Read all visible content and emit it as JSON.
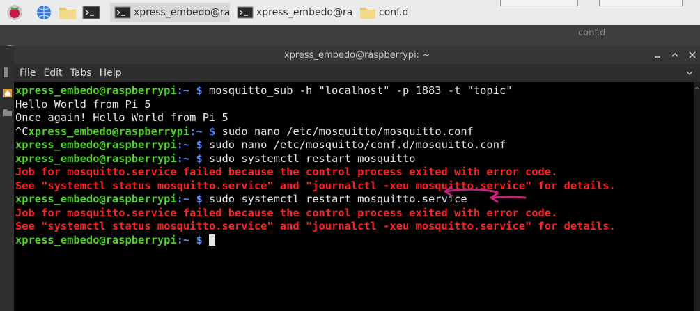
{
  "taskbar": {
    "tasks": [
      {
        "label": "xpress_embedo@ras..."
      },
      {
        "label": "xpress_embedo@ras..."
      },
      {
        "label": "conf.d"
      }
    ]
  },
  "background_window": {
    "title": "conf.d",
    "left_text": "Fi"
  },
  "terminal": {
    "title": "xpress_embedo@raspberrypi: ~",
    "menu": [
      "File",
      "Edit",
      "Tabs",
      "Help"
    ],
    "prompt_user": "xpress_embedo@raspberrypi",
    "prompt_path": ":~ $",
    "lines": [
      {
        "type": "cmd",
        "prefix": "",
        "text": " mosquitto_sub -h \"localhost\" -p 1883 -t \"topic\""
      },
      {
        "type": "out",
        "text": "Hello World from Pi 5"
      },
      {
        "type": "out",
        "text": "Once again! Hello World from Pi 5"
      },
      {
        "type": "cmd",
        "prefix": "^C",
        "text": " sudo nano /etc/mosquitto/mosquitto.conf"
      },
      {
        "type": "cmd",
        "prefix": "",
        "text": " sudo nano /etc/mosquitto/conf.d/mosquitto.conf"
      },
      {
        "type": "cmd",
        "prefix": "",
        "text": " sudo systemctl restart mosquitto"
      },
      {
        "type": "err",
        "text": "Job for mosquitto.service failed because the control process exited with error code."
      },
      {
        "type": "err",
        "text": "See \"systemctl status mosquitto.service\" and \"journalctl -xeu mosquitto.service\" for details."
      },
      {
        "type": "cmd",
        "prefix": "",
        "text": " sudo systemctl restart mosquitto.service"
      },
      {
        "type": "err",
        "text": "Job for mosquitto.service failed because the control process exited with error code."
      },
      {
        "type": "err",
        "text": "See \"systemctl status mosquitto.service\" and \"journalctl -xeu mosquitto.service\" for details."
      },
      {
        "type": "cmd",
        "prefix": "",
        "text": " "
      }
    ]
  },
  "colors": {
    "prompt_user": "#4fd42a",
    "prompt_path": "#5f8cff",
    "error_text": "#ff2323",
    "annotation_arrow": "#c0237a"
  }
}
